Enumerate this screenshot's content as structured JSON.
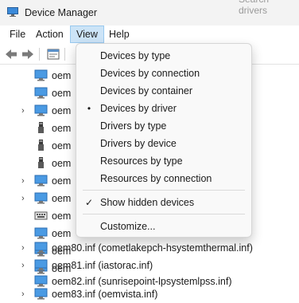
{
  "window": {
    "title": "Device Manager",
    "search_hint": "Search drivers"
  },
  "menubar": {
    "items": [
      "File",
      "Action",
      "View",
      "Help"
    ],
    "active": "View"
  },
  "view_menu": {
    "items": [
      {
        "label": "Devices by type",
        "mark": ""
      },
      {
        "label": "Devices by connection",
        "mark": ""
      },
      {
        "label": "Devices by container",
        "mark": ""
      },
      {
        "label": "Devices by driver",
        "mark": "•"
      },
      {
        "label": "Drivers by type",
        "mark": ""
      },
      {
        "label": "Drivers by device",
        "mark": ""
      },
      {
        "label": "Resources by type",
        "mark": ""
      },
      {
        "label": "Resources by connection",
        "mark": ""
      },
      {
        "label": "Show hidden devices",
        "mark": "✓"
      },
      {
        "label": "Customize...",
        "mark": ""
      }
    ]
  },
  "tree": {
    "rows": [
      {
        "label": "oem",
        "icon": "monitor-icon",
        "expander": false
      },
      {
        "label": "oem",
        "icon": "monitor-icon",
        "expander": false
      },
      {
        "label": "oem",
        "icon": "monitor-icon",
        "expander": true
      },
      {
        "label": "oem",
        "icon": "usb-icon",
        "expander": false
      },
      {
        "label": "oem",
        "icon": "usb-icon",
        "expander": false
      },
      {
        "label": "oem",
        "icon": "usb-icon",
        "expander": false
      },
      {
        "label": "oem",
        "icon": "monitor-icon",
        "expander": true
      },
      {
        "label": "oem",
        "icon": "monitor-icon",
        "expander": true
      },
      {
        "label": "oem",
        "icon": "keyboard-icon",
        "expander": false
      },
      {
        "label": "oem",
        "icon": "monitor-icon",
        "expander": false
      },
      {
        "label": "oem",
        "icon": "monitor-icon",
        "expander": false
      },
      {
        "label": "oem",
        "icon": "monitor-icon",
        "expander": false
      },
      {
        "label": "oem80.inf (cometlakepch-hsystemthermal.inf)",
        "icon": "monitor-icon",
        "expander": true
      },
      {
        "label": "oem81.inf (iastorac.inf)",
        "icon": "monitor-icon",
        "expander": true
      },
      {
        "label": "oem82.inf (sunrisepoint-lpsystemlpss.inf)",
        "icon": "monitor-icon",
        "expander": false
      },
      {
        "label": "oem83.inf (oemvista.inf)",
        "icon": "monitor-icon",
        "expander": true
      }
    ]
  }
}
